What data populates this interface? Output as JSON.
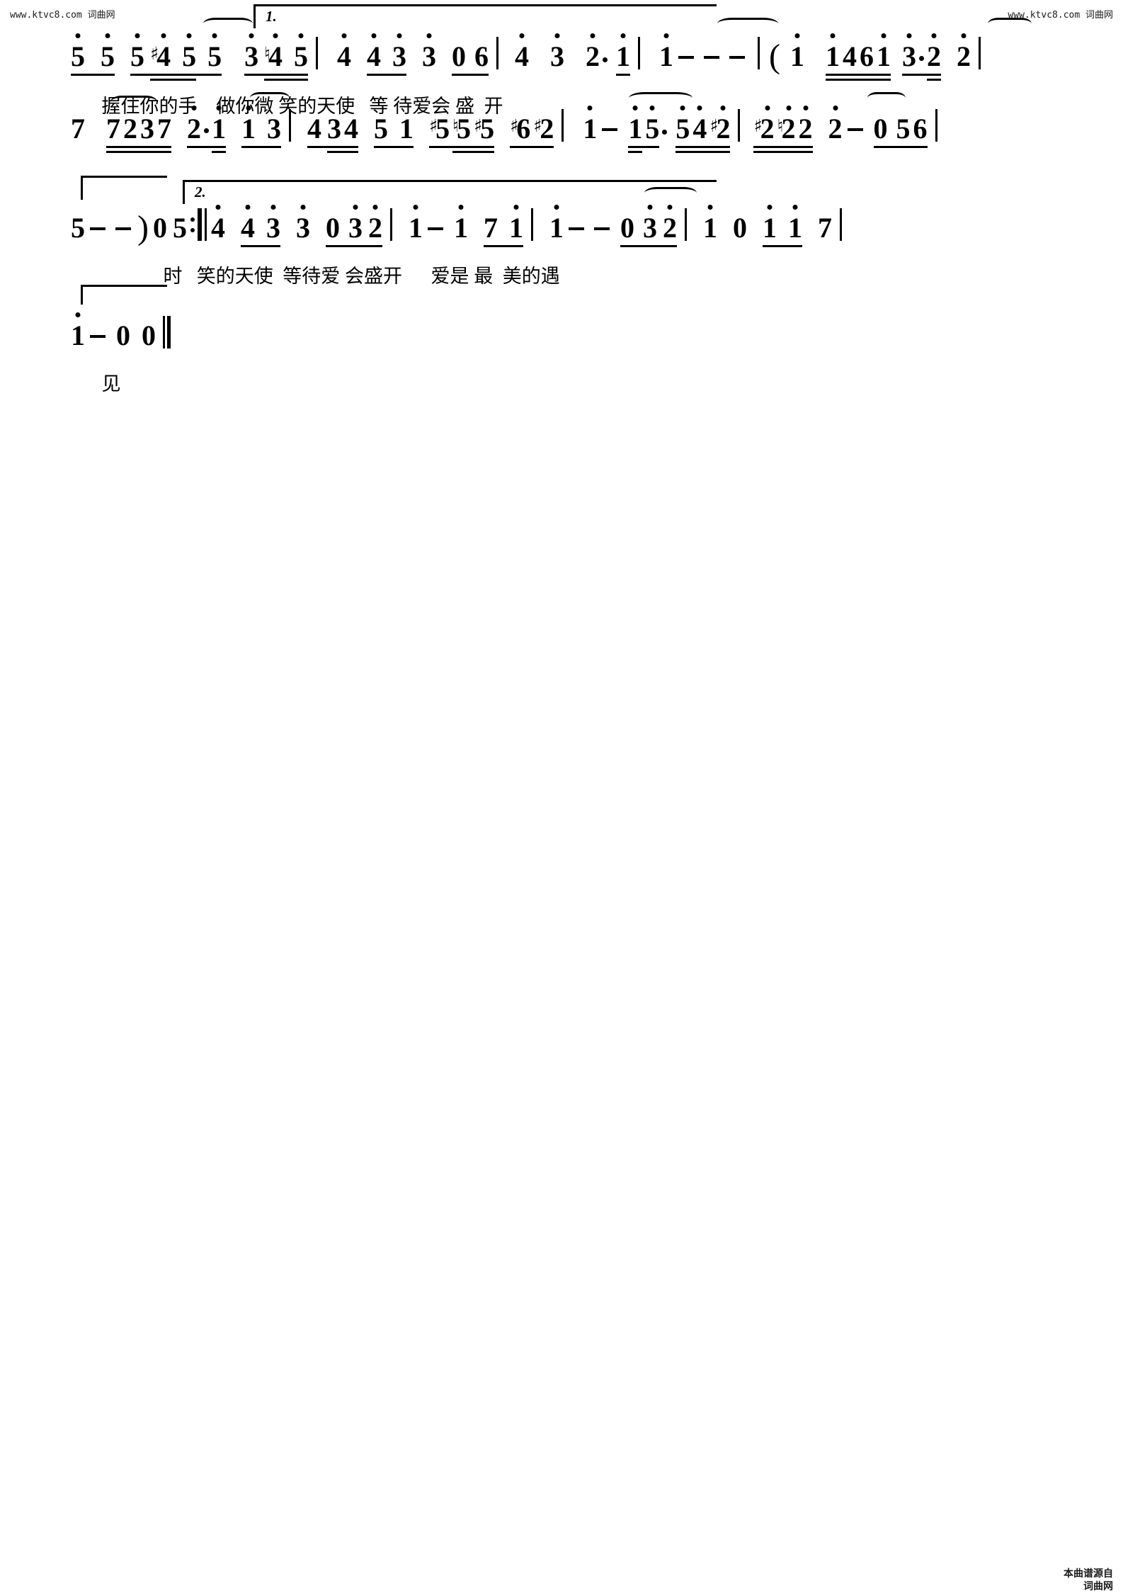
{
  "watermarks": {
    "top_left": "www.ktvc8.com 词曲网",
    "top_right": "www.ktvc8.com 词曲网",
    "bottom_right_1": "本曲谱源自",
    "bottom_right_2": "词曲网"
  },
  "notation": {
    "type": "jianpu-numbered-musical-notation",
    "voltas": {
      "first": "1.",
      "second": "2."
    }
  },
  "score": {
    "systems": [
      {
        "id": "system-1",
        "measures": "5 5 5 #4 5 5  3 ♮4 5 | 4 4 3 3 0 6 | 4 3 2 · 1 | 1 - - - | ( 1 1461 3·2 2 |",
        "lyrics": "握住你的手    做你微 笑的天使   等 待爱会 盛  开",
        "volta": "1."
      },
      {
        "id": "system-2",
        "measures": "7 7237 2·1 1 3 | 4 34 5 1 #5♮5#5 #6#2 | 1 - 15· 54#2 | #2♮22 2 - 0 56 |",
        "lyrics": ""
      },
      {
        "id": "system-3",
        "measures": "5 - - ) 0 5 :‖ 4 4 3 3 0 3 2 | 1 - 1 7 1 | 1 - - 0 3 2 | 1 0 1 1 7 |",
        "lyrics": "时   笑的天使  等待爱 会盛开      爱是 最  美的遇",
        "volta": "2."
      },
      {
        "id": "system-4",
        "measures": "1 - 0 0 ‖",
        "lyrics": "见"
      }
    ],
    "lyric_lines": {
      "line1": [
        "握",
        "住",
        "你",
        "的",
        "手",
        "做",
        "你",
        "微",
        "笑",
        "的",
        "天",
        "使",
        "等",
        "待",
        "爱",
        "会",
        "盛",
        "开"
      ],
      "line3": [
        "时",
        "笑",
        "的",
        "天",
        "使",
        "等",
        "待",
        "爱",
        "会",
        "盛",
        "开",
        "爱",
        "是",
        "最",
        "美",
        "的",
        "遇"
      ],
      "line4": [
        "见"
      ]
    }
  }
}
